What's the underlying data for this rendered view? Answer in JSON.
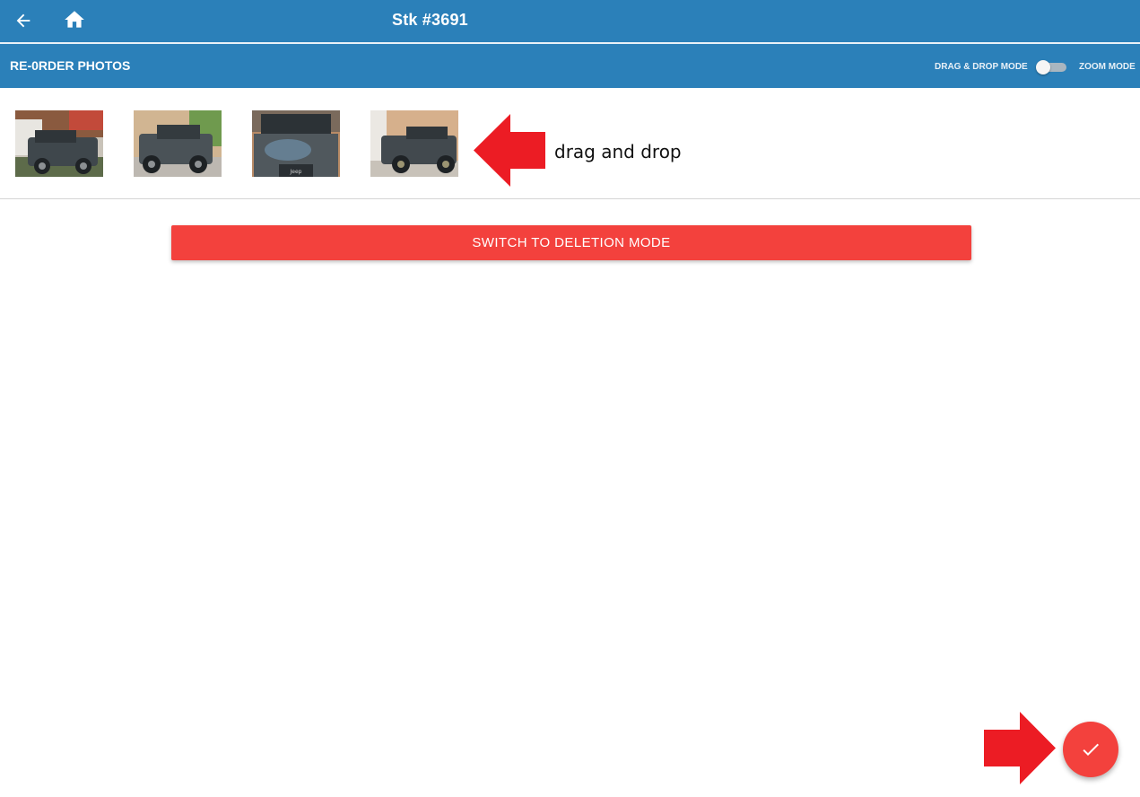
{
  "app_bar": {
    "title": "Stk #3691",
    "back_icon": "arrow-back-icon",
    "home_icon": "home-icon",
    "background": "#2b80b9"
  },
  "sub_bar": {
    "title": "RE-0RDER PHOTOS",
    "left_mode_label": "DRAG & DROP MODE",
    "right_mode_label": "ZOOM MODE",
    "toggle_on": false
  },
  "photos": [
    {
      "label": "jeep-photo-1"
    },
    {
      "label": "jeep-photo-2"
    },
    {
      "label": "jeep-photo-3"
    },
    {
      "label": "jeep-photo-4"
    }
  ],
  "annotation": {
    "text": "drag and drop",
    "arrow_color": "#ec1c24"
  },
  "deletion_button": {
    "label": "SWITCH TO DELETION MODE",
    "color": "#f3413d"
  },
  "confirm_button": {
    "icon": "check-icon",
    "color": "#f3413d"
  }
}
